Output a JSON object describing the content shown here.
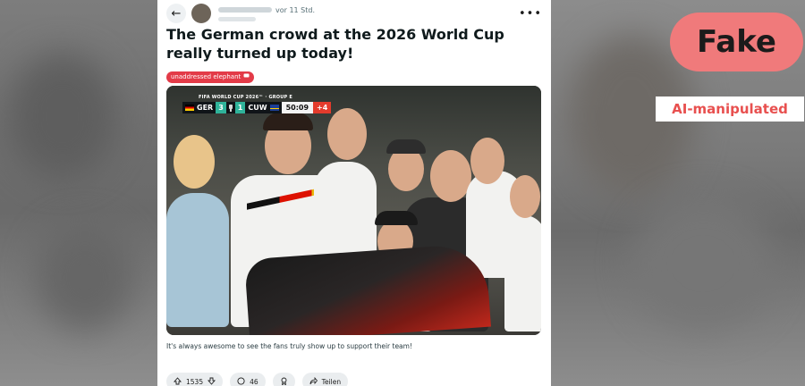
{
  "post": {
    "time_text": "vor 11 Std.",
    "title": "The German crowd at the 2026 World Cup really turned up today!",
    "flair": "unaddressed elephant",
    "caption": "It's always awesome to see the fans truly show up to support their team!",
    "more_icon": "•••",
    "back_icon": "←"
  },
  "scoreboard": {
    "competition": "FIFA WORLD CUP 2026™ · GROUP E",
    "home": "GER",
    "home_score": "3",
    "away_score": "1",
    "away": "CUW",
    "clock": "50:09",
    "added": "+4"
  },
  "actions": {
    "upvotes": "1535",
    "comments": "46",
    "share": "Teilen"
  },
  "overlay": {
    "verdict": "Fake",
    "label": "AI-manipulated"
  },
  "colors": {
    "verdict_bg": "#f07a7b",
    "label_text": "#e8504f",
    "flair_bg": "#e33b48"
  }
}
